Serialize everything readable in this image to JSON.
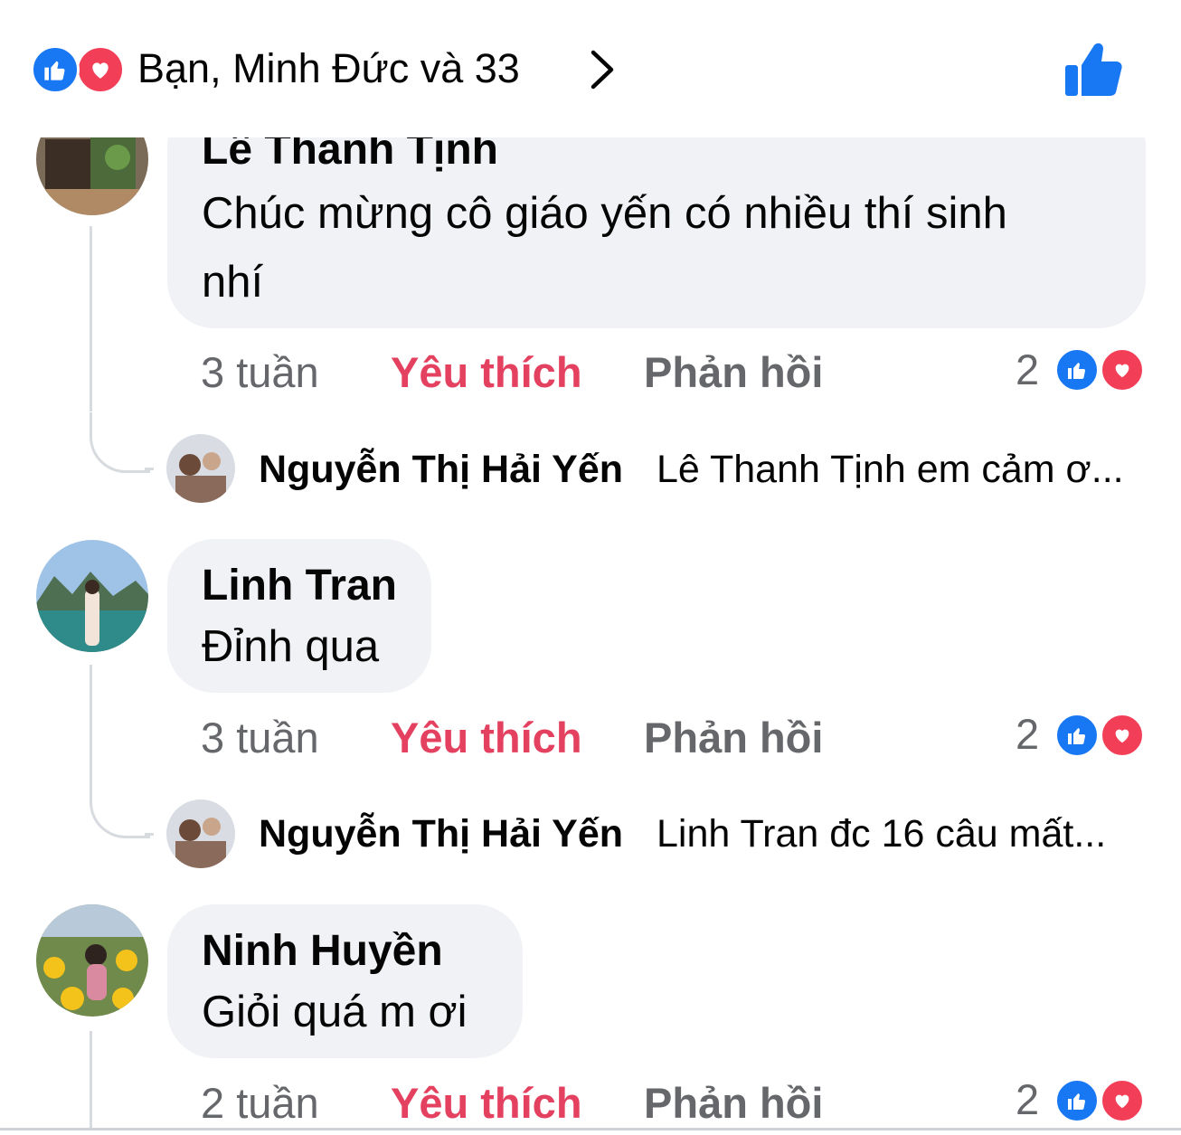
{
  "header": {
    "reactions_summary": "Bạn, Minh Đức và 33",
    "icons": [
      "like-reaction-icon",
      "love-reaction-icon",
      "chevron-right-icon",
      "thumbs-up-icon"
    ],
    "like_color": "#1877f2",
    "love_color": "#f33e58"
  },
  "comments": [
    {
      "author": "Lê Thanh Tịnh",
      "text_line1": "Chúc mừng cô giáo yến có nhiều thí sinh",
      "text_line2": "nhí",
      "time": "3 tuần",
      "like_label": "Yêu thích",
      "reply_label": "Phản hồi",
      "reaction_count": "2",
      "reply": {
        "author": "Nguyễn Thị Hải Yến",
        "preview": "Lê Thanh Tịnh em cảm ơ..."
      }
    },
    {
      "author": "Linh Tran",
      "text_line1": "Đỉnh qua",
      "time": "3 tuần",
      "like_label": "Yêu thích",
      "reply_label": "Phản hồi",
      "reaction_count": "2",
      "reply": {
        "author": "Nguyễn Thị Hải Yến",
        "preview": "Linh Tran đc 16 câu mất..."
      }
    },
    {
      "author": "Ninh Huyền",
      "text_line1": "Giỏi quá m ơi",
      "time": "2 tuần",
      "like_label": "Yêu thích",
      "reply_label": "Phản hồi",
      "reaction_count": "2"
    }
  ],
  "colors": {
    "liked_action": "#e4405f",
    "secondary_text": "#65676b",
    "bubble_bg": "#f0f2f5"
  }
}
